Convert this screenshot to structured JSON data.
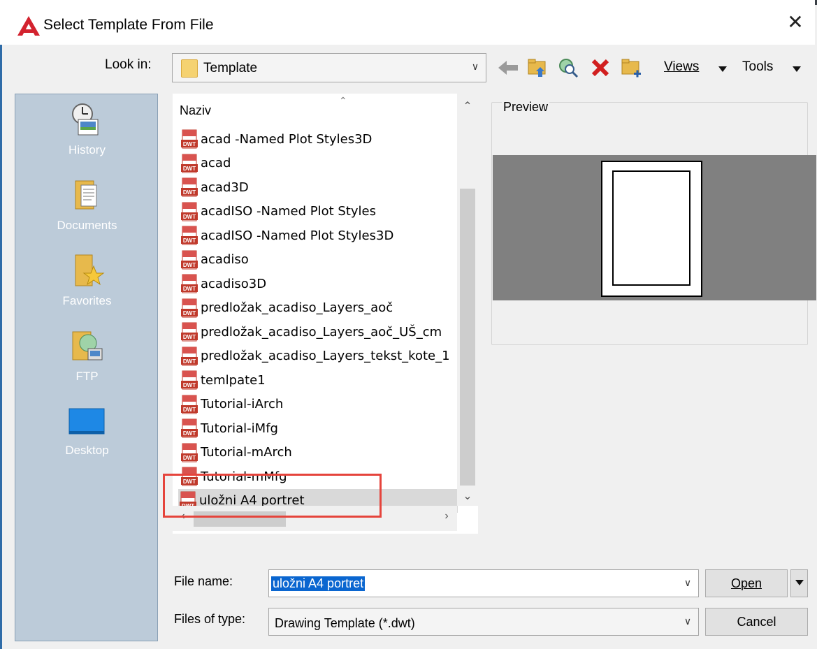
{
  "window": {
    "title": "Select Template From File",
    "close_glyph": "✕",
    "app_icon": "autocad-logo-icon"
  },
  "toolbar": {
    "look_in_label": "Look in:",
    "look_in_value": "Template",
    "views_label": "Views",
    "tools_label": "Tools",
    "buttons": [
      "back-icon",
      "up-folder-icon",
      "search-web-icon",
      "delete-icon",
      "new-folder-icon"
    ]
  },
  "places": [
    {
      "label": "History",
      "icon": "history-icon"
    },
    {
      "label": "Documents",
      "icon": "documents-icon"
    },
    {
      "label": "Favorites",
      "icon": "favorites-icon"
    },
    {
      "label": "FTP",
      "icon": "ftp-icon"
    },
    {
      "label": "Desktop",
      "icon": "desktop-icon"
    }
  ],
  "file_list": {
    "column_header": "Naziv",
    "files": [
      "acad -Named Plot Styles3D",
      "acad",
      "acad3D",
      "acadISO -Named Plot Styles",
      "acadISO -Named Plot Styles3D",
      "acadiso",
      "acadiso3D",
      "predložak_acadiso_Layers_aoč",
      "predložak_acadiso_Layers_aoč_UŠ_cm",
      "predložak_acadiso_Layers_tekst_kote_1",
      "temlpate1",
      "Tutorial-iArch",
      "Tutorial-iMfg",
      "Tutorial-mArch",
      "Tutorial-mMfg",
      "uložni A4 portret"
    ],
    "selected_index": 15,
    "file_icon_label": "DWT"
  },
  "preview": {
    "label": "Preview"
  },
  "form": {
    "file_name_label": "File name:",
    "file_name_value": "uložni A4 portret",
    "files_of_type_label": "Files of type:",
    "files_of_type_value": "Drawing Template (*.dwt)",
    "open_label": "Open",
    "cancel_label": "Cancel"
  },
  "colors": {
    "places_bg": "#bccbd9",
    "highlight": "#e5443c",
    "selection": "#0a66d0"
  }
}
